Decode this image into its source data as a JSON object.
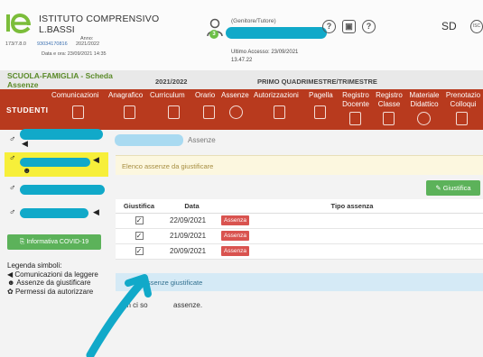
{
  "header": {
    "institute_line1": "ISTITUTO COMPRENSIVO",
    "institute_line2": "L.BASSI",
    "school_code_prefix": "173/7.8.0",
    "school_code": "93034170816",
    "year_label": "Anno:",
    "year_value": "2021/2022",
    "date_label": "Data e ora: 23/09/2021 14:35",
    "user_role": "(Genitore/Tutore)",
    "user_badge": "3",
    "last_access_label": "Ultimo Accesso: 23/09/2021",
    "last_access_time": "13.47.22",
    "icons": [
      "help-icon",
      "lock-icon",
      "question-icon"
    ],
    "brand": "SD"
  },
  "titlebar": {
    "section_title": "SCUOLA-FAMIGLIA - Scheda Assenze",
    "year": "2021/2022",
    "period": "PRIMO QUADRIMESTRE/TRIMESTRE"
  },
  "nav": {
    "students_label": "STUDENTI",
    "items": [
      {
        "label": "Comunicazioni",
        "icon": "megaphone-icon"
      },
      {
        "label": "Anagrafico",
        "icon": "document-icon"
      },
      {
        "label": "Curriculum",
        "icon": "document-icon"
      },
      {
        "label": "Orario",
        "icon": "calendar-icon"
      },
      {
        "label": "Assenze",
        "icon": "face-icon"
      },
      {
        "label": "Autorizzazioni",
        "icon": "calendar-check-icon"
      },
      {
        "label": "Pagella",
        "icon": "report-icon"
      },
      {
        "label": "Registro Docente",
        "icon": "book-icon"
      },
      {
        "label": "Registro Classe",
        "icon": "book-icon"
      },
      {
        "label": "Materiale Didattico",
        "icon": "gears-icon"
      },
      {
        "label": "Prenotazio Colloqui",
        "icon": "handshake-icon"
      }
    ]
  },
  "sidebar": {
    "covid_button": "Informativa COVID-19",
    "legend_title": "Legenda simboli:",
    "legend": [
      {
        "icon": "megaphone-icon",
        "text": "Comunicazioni da leggere"
      },
      {
        "icon": "smiley-icon",
        "text": "Assenze da giustificare"
      },
      {
        "icon": "paw-icon",
        "text": "Permessi da autorizzare"
      }
    ]
  },
  "main": {
    "breadcrumb": "Assenze",
    "to_justify_title": "Elenco assenze da giustificare",
    "justify_button": "Giustifica",
    "columns": [
      "Giustifica",
      "Data",
      "Tipo assenza"
    ],
    "rows": [
      {
        "date": "22/09/2021",
        "type": "Assenza"
      },
      {
        "date": "21/09/2021",
        "type": "Assenza"
      },
      {
        "date": "20/09/2021",
        "type": "Assenza"
      }
    ],
    "justified_title": "Assenze giustificate",
    "justified_title_visible": "ssenze giustificate",
    "justified_empty_visible": "on ci so",
    "justified_empty_tail": "assenze."
  }
}
